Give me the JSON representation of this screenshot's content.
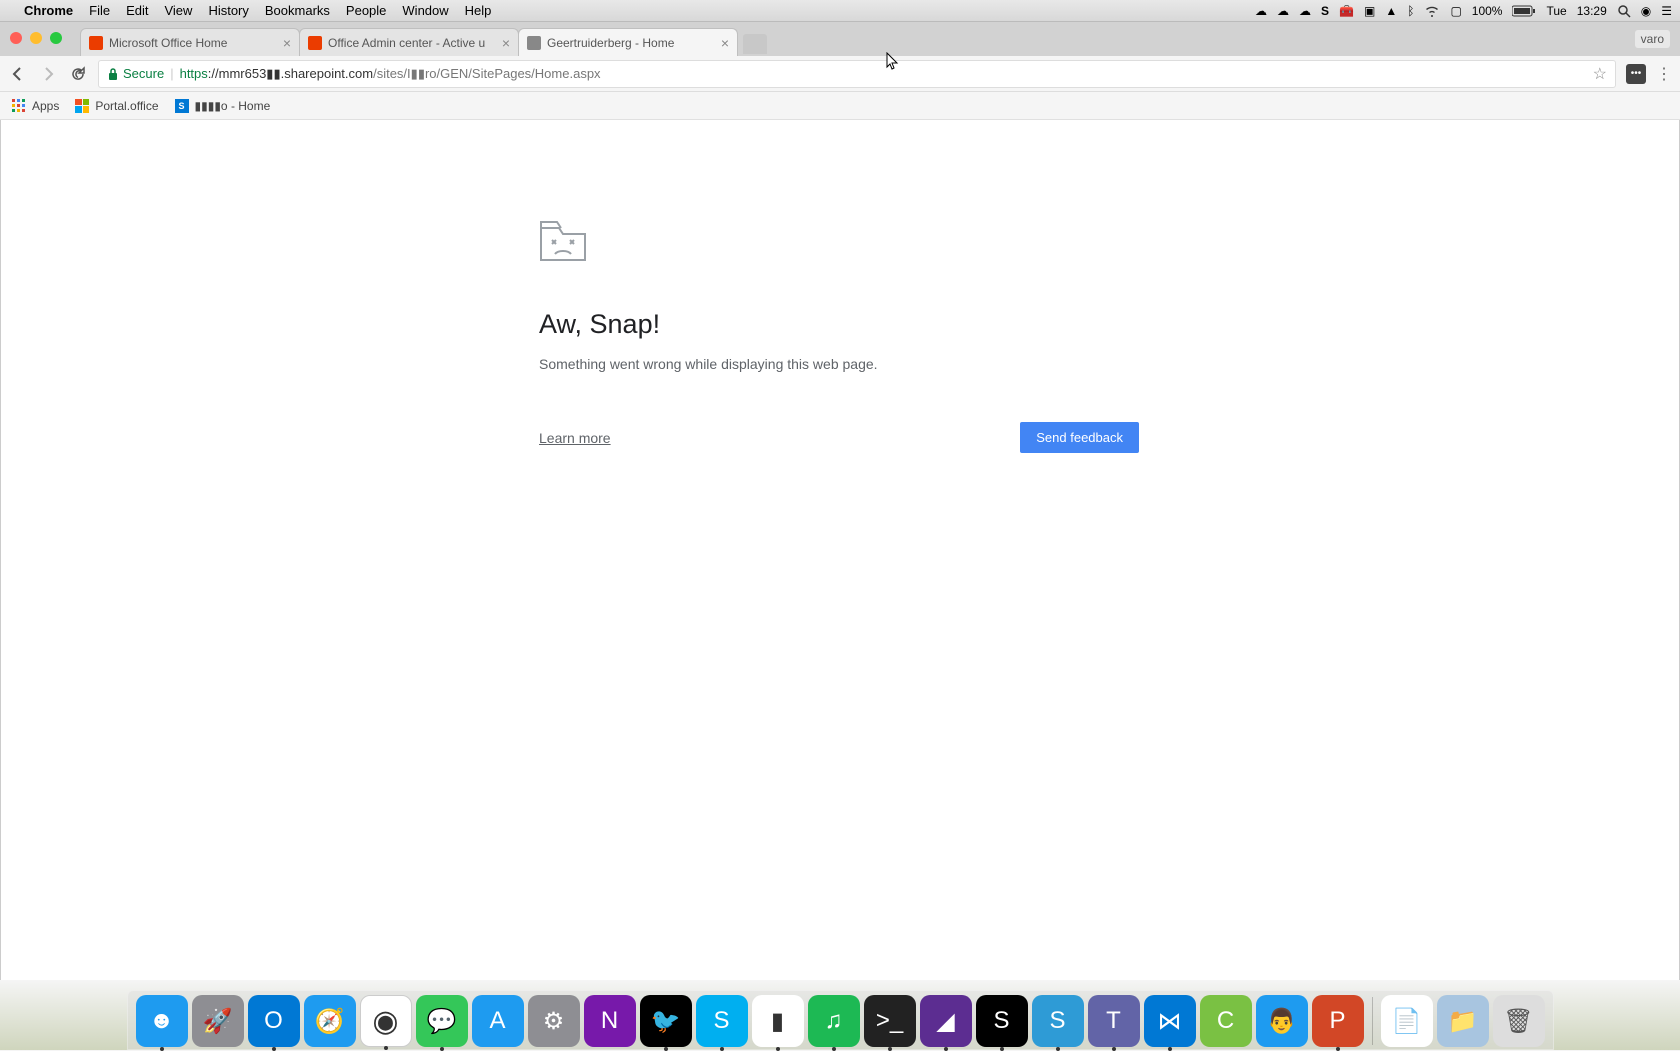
{
  "menubar": {
    "app": "Chrome",
    "items": [
      "File",
      "Edit",
      "View",
      "History",
      "Bookmarks",
      "People",
      "Window",
      "Help"
    ],
    "battery": "100%",
    "day": "Tue",
    "time": "13:29"
  },
  "chrome": {
    "user": "varo",
    "tabs": [
      {
        "title": "Microsoft Office Home",
        "active": false
      },
      {
        "title": "Office Admin center - Active u",
        "active": false
      },
      {
        "title": "Geertruiderberg - Home",
        "active": true
      }
    ],
    "secure_label": "Secure",
    "url_scheme": "https",
    "url_host": "://mmr653▮▮.sharepoint.com",
    "url_path": "/sites/I▮▮ro/GEN/SitePages/Home.aspx",
    "bookmarks": [
      {
        "label": "Apps",
        "icon": "apps"
      },
      {
        "label": "Portal.office",
        "icon": "ms"
      },
      {
        "label": "▮▮▮▮o - Home",
        "icon": "sp"
      }
    ]
  },
  "error": {
    "title": "Aw, Snap!",
    "message": "Something went wrong while displaying this web page.",
    "learn": "Learn more",
    "button": "Send feedback"
  },
  "dock": [
    {
      "name": "finder",
      "bg": "#1e9bf0",
      "glyph": "☻",
      "running": true
    },
    {
      "name": "launchpad",
      "bg": "#8e8e93",
      "glyph": "🚀"
    },
    {
      "name": "outlook",
      "bg": "#0078d4",
      "glyph": "O",
      "running": true
    },
    {
      "name": "safari",
      "bg": "#1e9bf0",
      "glyph": "🧭"
    },
    {
      "name": "chrome",
      "bg": "#fff",
      "glyph": "◉",
      "running": true
    },
    {
      "name": "messages",
      "bg": "#34c759",
      "glyph": "💬",
      "running": true
    },
    {
      "name": "appstore",
      "bg": "#1e9bf0",
      "glyph": "A"
    },
    {
      "name": "settings",
      "bg": "#8e8e93",
      "glyph": "⚙"
    },
    {
      "name": "onenote",
      "bg": "#7719aa",
      "glyph": "N"
    },
    {
      "name": "twitter",
      "bg": "#000",
      "glyph": "🐦",
      "running": true
    },
    {
      "name": "skype",
      "bg": "#00aff0",
      "glyph": "S",
      "running": true
    },
    {
      "name": "parallels",
      "bg": "#fff",
      "glyph": "▮",
      "running": true
    },
    {
      "name": "spotify",
      "bg": "#1db954",
      "glyph": "♫",
      "running": true
    },
    {
      "name": "terminal",
      "bg": "#222",
      "glyph": ">_",
      "running": true
    },
    {
      "name": "visualstudio",
      "bg": "#5c2d91",
      "glyph": "◢",
      "running": true
    },
    {
      "name": "sonos",
      "bg": "#000",
      "glyph": "S",
      "running": true
    },
    {
      "name": "snagit",
      "bg": "#2e9bd6",
      "glyph": "S",
      "running": true
    },
    {
      "name": "teams",
      "bg": "#6264a7",
      "glyph": "T",
      "running": true
    },
    {
      "name": "vscode",
      "bg": "#0078d4",
      "glyph": "⋈",
      "running": true
    },
    {
      "name": "camtasia",
      "bg": "#7ac143",
      "glyph": "C"
    },
    {
      "name": "franz",
      "bg": "#1e9bf0",
      "glyph": "👨"
    },
    {
      "name": "powerpoint",
      "bg": "#d24726",
      "glyph": "P",
      "running": true
    }
  ],
  "dock_right": [
    {
      "name": "document",
      "bg": "#fff",
      "glyph": "📄"
    },
    {
      "name": "folder",
      "bg": "#a8c5e0",
      "glyph": "📁"
    },
    {
      "name": "trash",
      "bg": "#ddd",
      "glyph": "🗑"
    }
  ]
}
